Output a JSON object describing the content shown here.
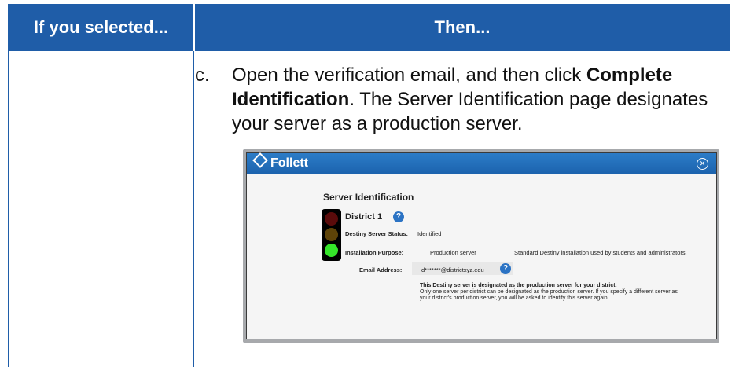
{
  "table": {
    "header_left": "If you selected...",
    "header_right": "Then..."
  },
  "step": {
    "letter": "c.",
    "text_before": "Open the verification email, and then click ",
    "text_bold": "Complete Identification",
    "text_after": ". The Server Identification page designates your server as a production server."
  },
  "dialog": {
    "logo": "Follett",
    "close_icon": "close-circle-icon",
    "title": "Server Identification",
    "district": "District 1",
    "status_label": "Destiny Server Status:",
    "status_value": "Identified",
    "purpose_label": "Installation Purpose:",
    "purpose_value": "Production server",
    "purpose_desc": "Standard Destiny installation used by students and administrators.",
    "email_label": "Email Address:",
    "email_value": "d*******@districtxyz.edu",
    "message_bold": "This Destiny server is designated as the production server for your district.",
    "message": "Only one server per district can be designated as the production server. If you specify a different server as your district's production server, you will be asked to identify this server again.",
    "light_colors": [
      "#5a0b0b",
      "#5e4308",
      "#35e52a"
    ]
  },
  "colors": {
    "header_blue": "#1f5da8",
    "bar_blue": "#1b62ad",
    "help_blue": "#2b73c4"
  }
}
